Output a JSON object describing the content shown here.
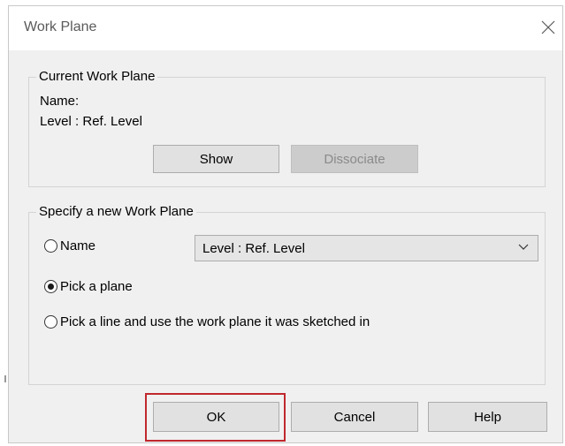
{
  "window": {
    "title": "Work Plane"
  },
  "current_work_plane": {
    "legend": "Current Work Plane",
    "name_label": "Name:",
    "name_value": "Level : Ref. Level",
    "show_label": "Show",
    "dissociate_label": "Dissociate"
  },
  "specify": {
    "legend": "Specify a new Work Plane",
    "options": [
      {
        "label": "Name",
        "checked": false
      },
      {
        "label": "Pick a plane",
        "checked": true
      },
      {
        "label": "Pick a line and use the work plane it was sketched in",
        "checked": false
      }
    ],
    "name_select": {
      "selected": "Level : Ref. Level"
    }
  },
  "footer": {
    "ok_label": "OK",
    "cancel_label": "Cancel",
    "help_label": "Help"
  },
  "colors": {
    "highlight": "#c0282d",
    "dialog_bg": "#f0f0f0",
    "button_bg": "#e1e1e1"
  }
}
